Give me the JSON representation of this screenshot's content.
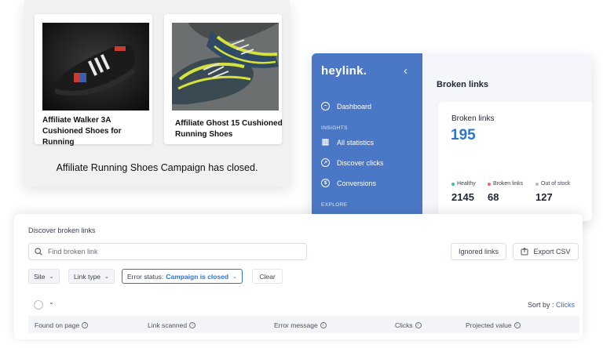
{
  "affiliate": {
    "products": [
      {
        "name": "Affiliate Walker 3A Cushioned Shoes for Running"
      },
      {
        "name": "Affiliate Ghost 15 Cushioned Running Shoes"
      }
    ],
    "message": "Affiliate Running Shoes Campaign has closed."
  },
  "dashboard": {
    "logo": "heylink.",
    "collapse_glyph": "‹",
    "nav": {
      "dashboard": "Dashboard",
      "section_insights": "INSIGHTS",
      "all_statistics": "All statistics",
      "discover_clicks": "Discover clicks",
      "conversions": "Conversions",
      "section_explore": "EXPLORE"
    },
    "page_title": "Broken links",
    "card": {
      "label": "Broken links",
      "value": "195",
      "legend": [
        {
          "label": "Healthy",
          "value": "2145",
          "color": "#34c79a"
        },
        {
          "label": "Broken links",
          "value": "68",
          "color": "#f0675f"
        },
        {
          "label": "Out of stock",
          "value": "127",
          "color": "#b3b8c2"
        }
      ]
    }
  },
  "panel": {
    "title": "Discover broken links",
    "search_placeholder": "Find broken link",
    "ignored_links": "Ignored links",
    "export_csv": "Export CSV",
    "filters": {
      "site": "Site",
      "link_type": "Link type",
      "error_status_label": "Error status:",
      "error_status_value": "Campaign is closed",
      "clear": "Clear"
    },
    "sort_label": "Sort by :",
    "sort_value": "Clicks",
    "columns": [
      "Found on page",
      "Link scanned",
      "Error message",
      "Clicks",
      "Projected value"
    ]
  }
}
